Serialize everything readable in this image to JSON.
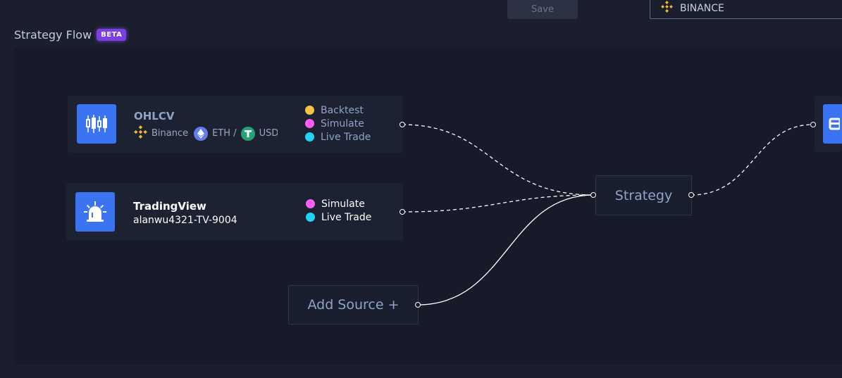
{
  "toolbar": {
    "save_label": "Save"
  },
  "exchange": {
    "selected": "BINANCE",
    "icon": "binance-icon"
  },
  "header": {
    "title": "Strategy Flow",
    "badge": "BETA"
  },
  "nodes": {
    "ohlcv": {
      "title": "OHLCV",
      "exchange": "Binance",
      "pair_base": "ETH /",
      "pair_quote": "USD",
      "icon": "candlestick-icon",
      "modes": [
        {
          "label": "Backtest",
          "color": "#f7c341"
        },
        {
          "label": "Simulate",
          "color": "#ff5ef2"
        },
        {
          "label": "Live Trade",
          "color": "#22d3f5"
        }
      ]
    },
    "tradingview": {
      "title": "TradingView",
      "subtitle": "alanwu4321-TV-9004",
      "icon": "alarm-icon",
      "modes": [
        {
          "label": "Simulate",
          "color": "#ff5ef2"
        },
        {
          "label": "Live Trade",
          "color": "#22d3f5"
        }
      ]
    },
    "add_source": {
      "label": "Add Source +"
    },
    "strategy": {
      "label": "Strategy"
    }
  },
  "colors": {
    "accent": "#3a74f2",
    "beta": "#7b3fe4",
    "binance": "#f3ba2f",
    "eth": "#627eea",
    "tether": "#26a17b"
  }
}
